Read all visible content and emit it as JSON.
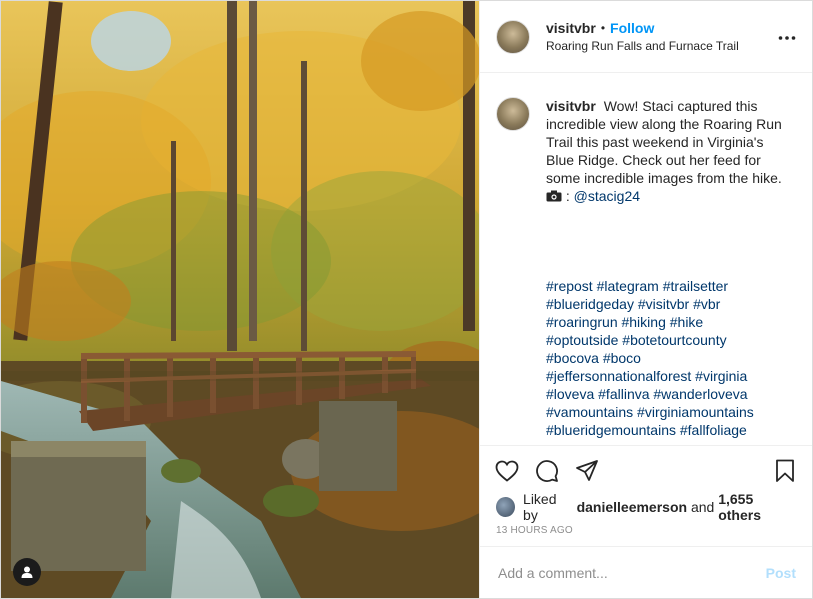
{
  "header": {
    "username": "visitvbr",
    "separator": "•",
    "follow_label": "Follow",
    "location": "Roaring Run Falls and Furnace Trail",
    "more_icon": "more-options-icon"
  },
  "caption": {
    "username": "visitvbr",
    "text": "Wow! Staci captured this incredible view along the Roaring Run Trail this past weekend in Virginia's Blue Ridge. Check out her feed for some incredible images from the hike.",
    "camera_icon": "camera-icon",
    "mention": "@stacig24",
    "hashtags": [
      "#repost #lategram #trailsetter",
      "#blueridgeday #visitvbr #vbr",
      "#roaringrun #hiking #hike",
      "#optoutside #botetourtcounty",
      "#bocova #boco",
      "#jeffersonnationalforest #virginia",
      "#loveva #fallinva #wanderloveva",
      "#vamountains #virginiamountains",
      "#blueridgemountains #fallfoliage"
    ]
  },
  "actions": {
    "icons": [
      "heart-icon",
      "comment-icon",
      "share-icon",
      "bookmark-icon"
    ]
  },
  "likes": {
    "prefix": "Liked by",
    "user": "danielleemerson",
    "joiner": "and",
    "others": "1,655 others"
  },
  "timestamp": "13 HOURS AGO",
  "comment": {
    "placeholder": "Add a comment...",
    "post_label": "Post"
  },
  "colors": {
    "link_blue": "#0095f6",
    "hashtag_blue": "#00376b",
    "post_disabled": "#b2dffc"
  }
}
